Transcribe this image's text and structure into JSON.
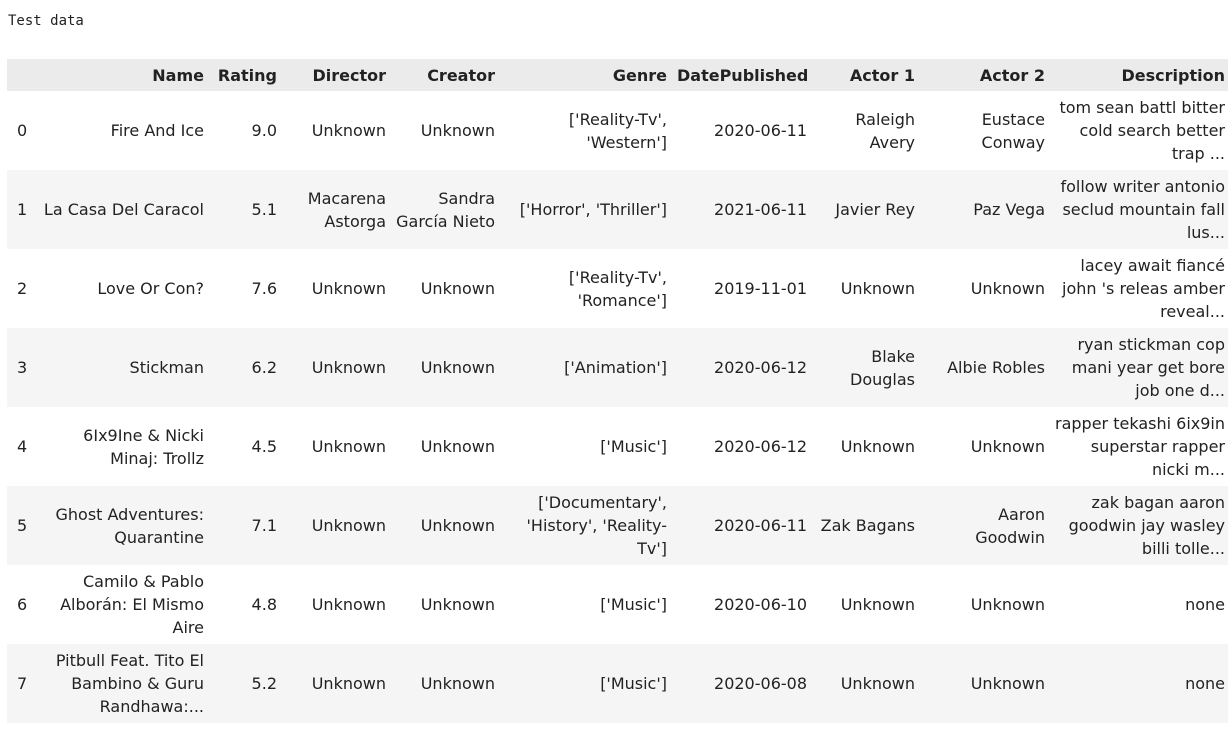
{
  "output_label": "Test data",
  "columns": [
    "",
    "Name",
    "Rating",
    "Director",
    "Creator",
    "Genre",
    "DatePublished",
    "Actor 1",
    "Actor 2",
    "Description"
  ],
  "rows": [
    [
      "0",
      "Fire And Ice",
      "9.0",
      "Unknown",
      "Unknown",
      "['Reality-Tv', 'Western']",
      "2020-06-11",
      "Raleigh Avery",
      "Eustace Conway",
      "tom sean battl bitter cold search better trap ..."
    ],
    [
      "1",
      "La Casa Del Caracol",
      "5.1",
      "Macarena Astorga",
      "Sandra García Nieto",
      "['Horror', 'Thriller']",
      "2021-06-11",
      "Javier Rey",
      "Paz Vega",
      "follow writer antonio seclud mountain fall lus..."
    ],
    [
      "2",
      "Love Or Con?",
      "7.6",
      "Unknown",
      "Unknown",
      "['Reality-Tv', 'Romance']",
      "2019-11-01",
      "Unknown",
      "Unknown",
      "lacey await fiancé john 's releas amber reveal..."
    ],
    [
      "3",
      "Stickman",
      "6.2",
      "Unknown",
      "Unknown",
      "['Animation']",
      "2020-06-12",
      "Blake Douglas",
      "Albie Robles",
      "ryan stickman cop mani year get bore job one d..."
    ],
    [
      "4",
      "6Ix9Ine & Nicki Minaj: Trollz",
      "4.5",
      "Unknown",
      "Unknown",
      "['Music']",
      "2020-06-12",
      "Unknown",
      "Unknown",
      "rapper tekashi 6ix9in superstar rapper nicki m..."
    ],
    [
      "5",
      "Ghost Adventures: Quarantine",
      "7.1",
      "Unknown",
      "Unknown",
      "['Documentary', 'History', 'Reality-Tv']",
      "2020-06-11",
      "Zak Bagans",
      "Aaron Goodwin",
      "zak bagan aaron goodwin jay wasley billi tolle..."
    ],
    [
      "6",
      "Camilo & Pablo Alborán: El Mismo Aire",
      "4.8",
      "Unknown",
      "Unknown",
      "['Music']",
      "2020-06-10",
      "Unknown",
      "Unknown",
      "none"
    ],
    [
      "7",
      "Pitbull Feat. Tito El Bambino & Guru Randhawa:...",
      "5.2",
      "Unknown",
      "Unknown",
      "['Music']",
      "2020-06-08",
      "Unknown",
      "Unknown",
      "none"
    ]
  ]
}
